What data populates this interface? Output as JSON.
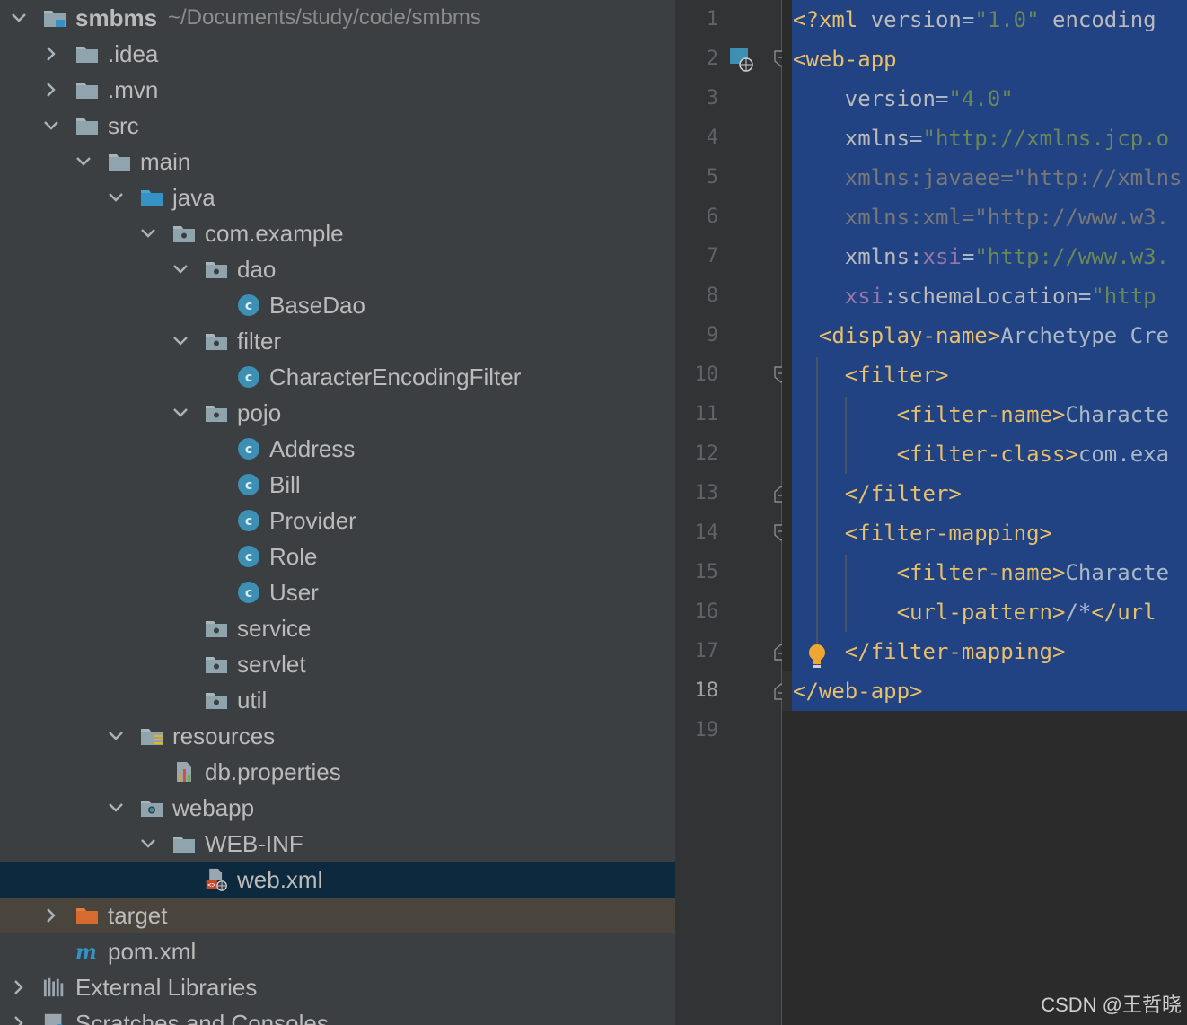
{
  "project_tree": {
    "items": [
      {
        "label": "smbms",
        "path": "~/Documents/study/code/smbms",
        "depth": 0,
        "expanded": true,
        "icon": "module-folder-icon"
      },
      {
        "label": ".idea",
        "depth": 1,
        "expanded": false,
        "icon": "folder-icon"
      },
      {
        "label": ".mvn",
        "depth": 1,
        "expanded": false,
        "icon": "folder-icon"
      },
      {
        "label": "src",
        "depth": 1,
        "expanded": true,
        "icon": "folder-icon"
      },
      {
        "label": "main",
        "depth": 2,
        "expanded": true,
        "icon": "folder-icon"
      },
      {
        "label": "java",
        "depth": 3,
        "expanded": true,
        "icon": "source-root-folder-icon"
      },
      {
        "label": "com.example",
        "depth": 4,
        "expanded": true,
        "icon": "package-icon"
      },
      {
        "label": "dao",
        "depth": 5,
        "expanded": true,
        "icon": "package-icon"
      },
      {
        "label": "BaseDao",
        "depth": 6,
        "icon": "java-class-icon"
      },
      {
        "label": "filter",
        "depth": 5,
        "expanded": true,
        "icon": "package-icon"
      },
      {
        "label": "CharacterEncodingFilter",
        "depth": 6,
        "icon": "java-class-icon"
      },
      {
        "label": "pojo",
        "depth": 5,
        "expanded": true,
        "icon": "package-icon"
      },
      {
        "label": "Address",
        "depth": 6,
        "icon": "java-class-icon"
      },
      {
        "label": "Bill",
        "depth": 6,
        "icon": "java-class-icon"
      },
      {
        "label": "Provider",
        "depth": 6,
        "icon": "java-class-icon"
      },
      {
        "label": "Role",
        "depth": 6,
        "icon": "java-class-icon"
      },
      {
        "label": "User",
        "depth": 6,
        "icon": "java-class-icon"
      },
      {
        "label": "service",
        "depth": 5,
        "icon": "package-icon"
      },
      {
        "label": "servlet",
        "depth": 5,
        "icon": "package-icon"
      },
      {
        "label": "util",
        "depth": 5,
        "icon": "package-icon"
      },
      {
        "label": "resources",
        "depth": 3,
        "expanded": true,
        "icon": "resources-folder-icon"
      },
      {
        "label": "db.properties",
        "depth": 4,
        "icon": "properties-file-icon"
      },
      {
        "label": "webapp",
        "depth": 3,
        "expanded": true,
        "icon": "web-folder-icon"
      },
      {
        "label": "WEB-INF",
        "depth": 4,
        "expanded": true,
        "icon": "folder-icon"
      },
      {
        "label": "web.xml",
        "depth": 5,
        "icon": "web-xml-file-icon",
        "selected": true
      },
      {
        "label": "target",
        "depth": 1,
        "expanded": false,
        "icon": "excluded-folder-icon",
        "excluded": true
      },
      {
        "label": "pom.xml",
        "depth": 1,
        "icon": "maven-icon"
      },
      {
        "label": "External Libraries",
        "depth": 0,
        "expanded": false,
        "icon": "libraries-icon"
      },
      {
        "label": "Scratches and Consoles",
        "depth": 0,
        "expanded": false,
        "icon": "scratches-icon"
      }
    ]
  },
  "editor": {
    "current_line": 18,
    "lines": [
      {
        "n": "1",
        "tokens": [
          {
            "c": "tag",
            "t": "<?xml "
          },
          {
            "c": "attr",
            "t": "version"
          },
          {
            "c": "txt",
            "t": "="
          },
          {
            "c": "val",
            "t": "\"1.0\""
          },
          {
            "c": "attr",
            "t": " encoding"
          }
        ]
      },
      {
        "n": "2",
        "tokens": [
          {
            "c": "tag",
            "t": "<web-app"
          }
        ]
      },
      {
        "n": "3",
        "tokens": [
          {
            "c": "attr",
            "t": "    version"
          },
          {
            "c": "txt",
            "t": "="
          },
          {
            "c": "val",
            "t": "\"4.0\""
          }
        ]
      },
      {
        "n": "4",
        "tokens": [
          {
            "c": "attr",
            "t": "    xmlns"
          },
          {
            "c": "txt",
            "t": "="
          },
          {
            "c": "val",
            "t": "\"http://xmlns.jcp.o"
          }
        ]
      },
      {
        "n": "5",
        "tokens": [
          {
            "c": "dim",
            "t": "    xmlns:javaee=\"http://xmlns"
          }
        ]
      },
      {
        "n": "6",
        "tokens": [
          {
            "c": "dim",
            "t": "    xmlns:xml=\"http://www.w3."
          }
        ]
      },
      {
        "n": "7",
        "tokens": [
          {
            "c": "attr",
            "t": "    xmlns:"
          },
          {
            "c": "ns",
            "t": "xsi"
          },
          {
            "c": "txt",
            "t": "="
          },
          {
            "c": "val",
            "t": "\"http://www.w3."
          }
        ]
      },
      {
        "n": "8",
        "tokens": [
          {
            "c": "ns",
            "t": "    xsi"
          },
          {
            "c": "attr",
            "t": ":schemaLocation"
          },
          {
            "c": "txt",
            "t": "="
          },
          {
            "c": "val",
            "t": "\"http"
          }
        ]
      },
      {
        "n": "9",
        "tokens": [
          {
            "c": "tag",
            "t": "  <display-name>"
          },
          {
            "c": "txt",
            "t": "Archetype Cre"
          }
        ]
      },
      {
        "n": "10",
        "tokens": [
          {
            "c": "tag",
            "t": "    <filter>"
          }
        ]
      },
      {
        "n": "11",
        "tokens": [
          {
            "c": "tag",
            "t": "        <filter-name>"
          },
          {
            "c": "txt",
            "t": "Characte"
          }
        ]
      },
      {
        "n": "12",
        "tokens": [
          {
            "c": "tag",
            "t": "        <filter-class>"
          },
          {
            "c": "txt",
            "t": "com.exa"
          }
        ]
      },
      {
        "n": "13",
        "tokens": [
          {
            "c": "tag",
            "t": "    </filter>"
          }
        ]
      },
      {
        "n": "14",
        "tokens": [
          {
            "c": "tag",
            "t": "    <filter-mapping>"
          }
        ]
      },
      {
        "n": "15",
        "tokens": [
          {
            "c": "tag",
            "t": "        <filter-name>"
          },
          {
            "c": "txt",
            "t": "Characte"
          }
        ]
      },
      {
        "n": "16",
        "tokens": [
          {
            "c": "tag",
            "t": "        <url-pattern>"
          },
          {
            "c": "txt",
            "t": "/*"
          },
          {
            "c": "tag",
            "t": "</url"
          }
        ]
      },
      {
        "n": "17",
        "tokens": [
          {
            "c": "tag",
            "t": "    </filter-mapping>"
          }
        ]
      },
      {
        "n": "18",
        "tokens": [
          {
            "c": "tag",
            "t": "</web-app>"
          }
        ]
      },
      {
        "n": "19",
        "tokens": []
      }
    ]
  },
  "watermark": "CSDN @王哲晓",
  "colors": {
    "tree_bg": "#3c3f41",
    "selected_row": "#0d293e",
    "excluded_row": "#49443c",
    "editor_bg": "#2b2b2b",
    "selection": "#214283",
    "xml_tag": "#e8bf6a",
    "xml_value": "#6a8759"
  }
}
